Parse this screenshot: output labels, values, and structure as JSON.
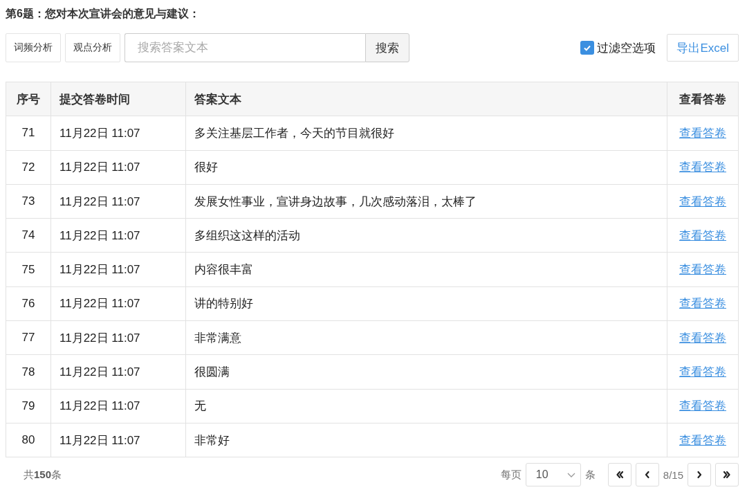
{
  "title": "第6题：您对本次宣讲会的意见与建议：",
  "toolbar": {
    "buttons": [
      "词频分析",
      "观点分析"
    ],
    "search": {
      "placeholder": "搜索答案文本",
      "button": "搜索"
    },
    "filter": {
      "label": "过滤空选项",
      "checked": true
    },
    "export": "导出Excel"
  },
  "table": {
    "columns": [
      "序号",
      "提交答卷时间",
      "答案文本",
      "查看答卷"
    ],
    "rows": [
      {
        "index": "71",
        "time": "11月22日 11:07",
        "answer": "多关注基层工作者，今天的节目就很好",
        "link": "查看答卷"
      },
      {
        "index": "72",
        "time": "11月22日 11:07",
        "answer": "很好",
        "link": "查看答卷"
      },
      {
        "index": "73",
        "time": "11月22日 11:07",
        "answer": "发展女性事业，宣讲身边故事，几次感动落泪，太棒了",
        "link": "查看答卷"
      },
      {
        "index": "74",
        "time": "11月22日 11:07",
        "answer": "多组织这这样的活动",
        "link": "查看答卷"
      },
      {
        "index": "75",
        "time": "11月22日 11:07",
        "answer": "内容很丰富",
        "link": "查看答卷"
      },
      {
        "index": "76",
        "time": "11月22日 11:07",
        "answer": "讲的特别好",
        "link": "查看答卷"
      },
      {
        "index": "77",
        "time": "11月22日 11:07",
        "answer": "非常满意",
        "link": "查看答卷"
      },
      {
        "index": "78",
        "time": "11月22日 11:07",
        "answer": "很圆满",
        "link": "查看答卷"
      },
      {
        "index": "79",
        "time": "11月22日 11:07",
        "answer": "无",
        "link": "查看答卷"
      },
      {
        "index": "80",
        "time": "11月22日 11:07",
        "answer": "非常好",
        "link": "查看答卷"
      }
    ]
  },
  "footer": {
    "total": "共**150**条",
    "per_page_label": "每页",
    "per_page": "10",
    "per_page_unit": "条",
    "page": "8/15"
  }
}
